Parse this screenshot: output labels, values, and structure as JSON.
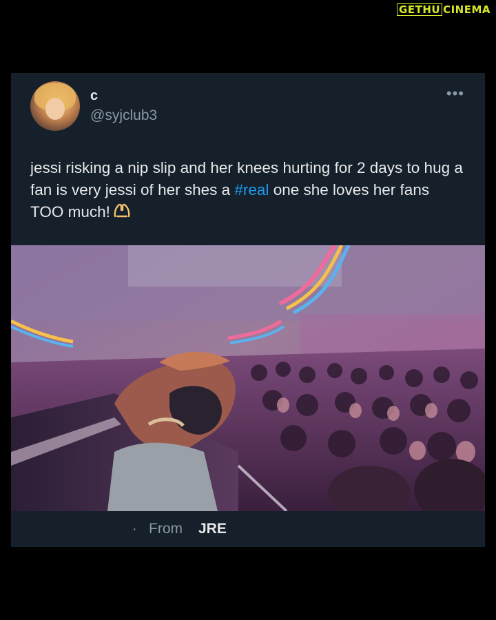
{
  "watermark": {
    "part_a": "GETHU",
    "part_b": "CINEMA",
    "color": "#d7e629"
  },
  "tweet": {
    "display_name": "c",
    "handle": "@syjclub3",
    "more_icon": "more-horizontal-icon",
    "text_before_hashtag": "jessi risking a nip slip and her knees hurting for 2 days to hug a fan is very jessi of her shes a ",
    "hashtag": "#real",
    "text_after_hashtag": " one she loves her fans TOO much!",
    "emoji_icon": "heart-hands-icon",
    "media_icon": "concert-photo",
    "from_dot": "·",
    "from_label": "From",
    "from_source": "JRE"
  },
  "colors": {
    "page_background": "#000000",
    "card_background": "#15202b",
    "primary_text": "#e7e9ea",
    "secondary_text": "#8b98a5",
    "link": "#1d9bf0"
  }
}
